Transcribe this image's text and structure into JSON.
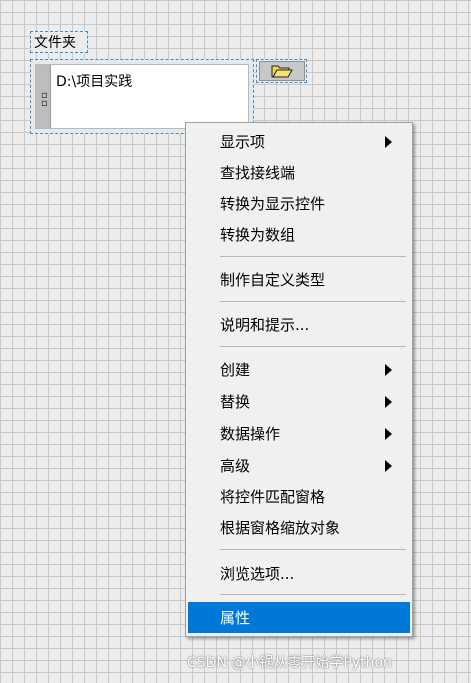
{
  "control": {
    "label": "文件夹",
    "path_value": "D:\\项目实践",
    "handle_glyph": "▫",
    "browse_icon": "folder-open-icon"
  },
  "menu": {
    "items": [
      {
        "label": "显示项",
        "submenu": true
      },
      {
        "label": "查找接线端",
        "submenu": false
      },
      {
        "label": "转换为显示控件",
        "submenu": false
      },
      {
        "label": "转换为数组",
        "submenu": false
      },
      {
        "label": "制作自定义类型",
        "submenu": false
      },
      {
        "label": "说明和提示...",
        "submenu": false
      },
      {
        "label": "创建",
        "submenu": true
      },
      {
        "label": "替换",
        "submenu": true
      },
      {
        "label": "数据操作",
        "submenu": true
      },
      {
        "label": "高级",
        "submenu": true
      },
      {
        "label": "将控件匹配窗格",
        "submenu": false
      },
      {
        "label": "根据窗格缩放对象",
        "submenu": false
      },
      {
        "label": "浏览选项...",
        "submenu": false
      },
      {
        "label": "属性",
        "submenu": false,
        "selected": true
      }
    ],
    "selection_color": "#0078d7"
  },
  "watermark": "CSDN @小锅从零开始学Python"
}
